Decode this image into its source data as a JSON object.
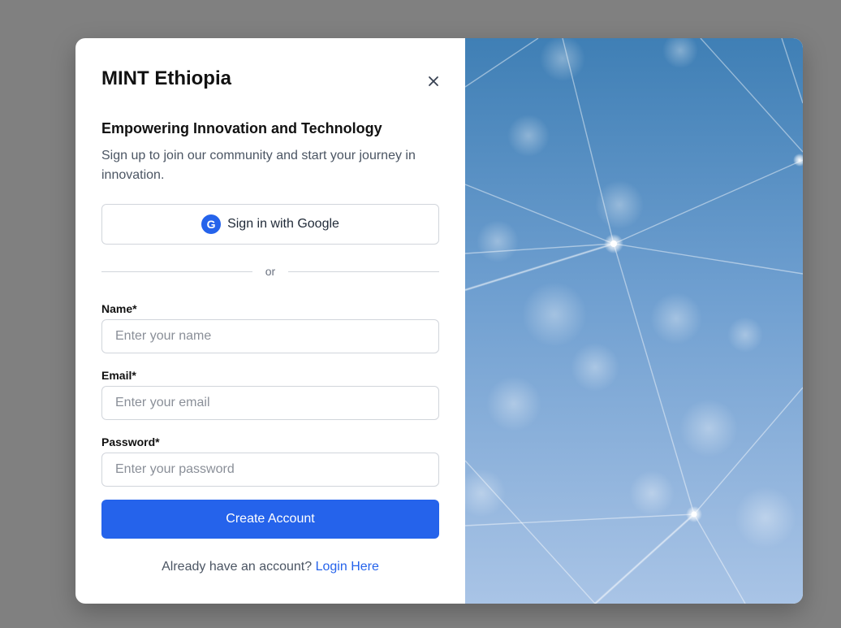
{
  "brand": {
    "title": "MINT Ethiopia"
  },
  "close": {
    "label": "×"
  },
  "intro": {
    "heading": "Empowering Innovation and Technology",
    "subtext": "Sign up to join our community and start your journey in innovation."
  },
  "google": {
    "badge": "G",
    "label": "Sign in with Google"
  },
  "divider": {
    "text": "or"
  },
  "form": {
    "name": {
      "label": "Name*",
      "placeholder": "Enter your name",
      "value": ""
    },
    "email": {
      "label": "Email*",
      "placeholder": "Enter your email",
      "value": ""
    },
    "password": {
      "label": "Password*",
      "placeholder": "Enter your password",
      "value": ""
    },
    "submit": "Create Account"
  },
  "footer": {
    "prompt": "Already have an account?",
    "link": "Login Here"
  },
  "colors": {
    "accent": "#2563eb",
    "overlay": "#808080",
    "text_muted": "#4b5563"
  },
  "image": {
    "description_icon": "network-sky-image"
  }
}
